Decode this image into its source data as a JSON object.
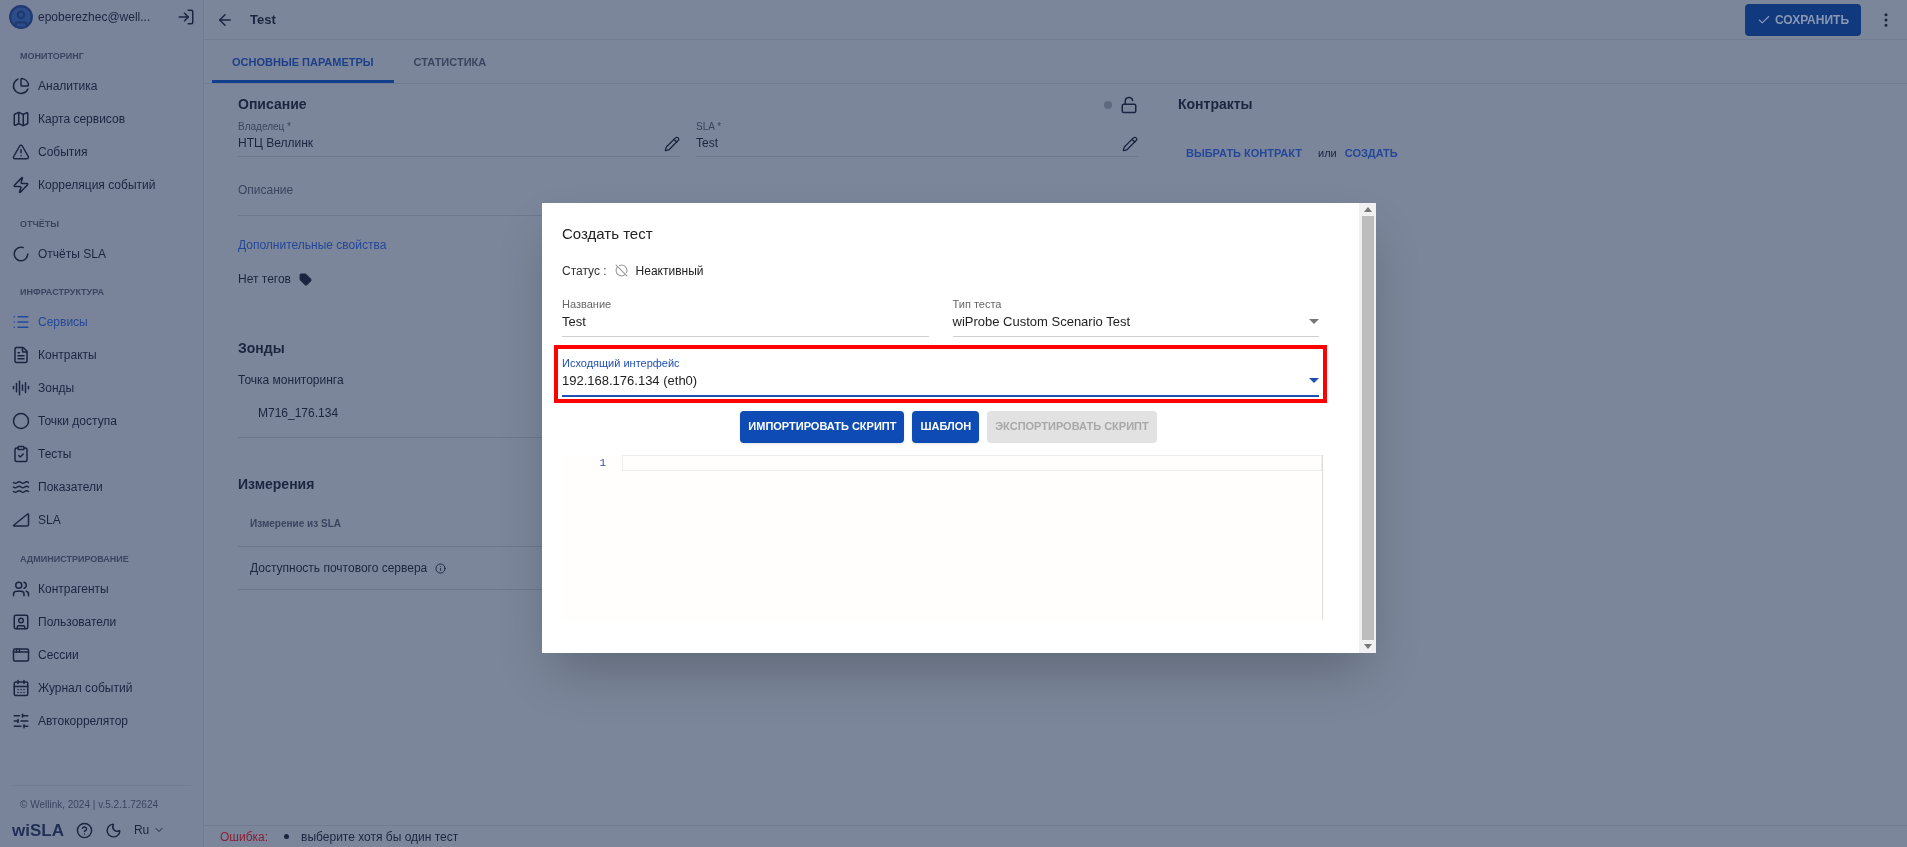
{
  "user": {
    "name": "epoberezhec@well..."
  },
  "sidebar": {
    "sections": [
      {
        "title": "МОНИТОРИНГ",
        "items": [
          {
            "label": "Аналитика",
            "selected": false
          },
          {
            "label": "Карта сервисов",
            "selected": false
          },
          {
            "label": "События",
            "selected": false
          },
          {
            "label": "Корреляция событий",
            "selected": false
          }
        ]
      },
      {
        "title": "ОТЧЁТЫ",
        "items": [
          {
            "label": "Отчёты SLA",
            "selected": false
          }
        ]
      },
      {
        "title": "ИНФРАСТРУКТУРА",
        "items": [
          {
            "label": "Сервисы",
            "selected": true
          },
          {
            "label": "Контракты",
            "selected": false
          },
          {
            "label": "Зонды",
            "selected": false
          },
          {
            "label": "Точки доступа",
            "selected": false
          },
          {
            "label": "Тесты",
            "selected": false
          },
          {
            "label": "Показатели",
            "selected": false
          },
          {
            "label": "SLA",
            "selected": false
          }
        ]
      },
      {
        "title": "АДМИНИСТРИРОВАНИЕ",
        "items": [
          {
            "label": "Контрагенты",
            "selected": false
          },
          {
            "label": "Пользователи",
            "selected": false
          },
          {
            "label": "Сессии",
            "selected": false
          },
          {
            "label": "Журнал событий",
            "selected": false
          },
          {
            "label": "Автокоррелятор",
            "selected": false
          }
        ]
      }
    ],
    "footer": "© Wellink, 2024 | v.5.2.1.72624",
    "logo": "wiSLA",
    "language": "Ru"
  },
  "header": {
    "title": "Test",
    "save_button": "СОХРАНИТЬ"
  },
  "tabs": [
    {
      "label": "ОСНОВНЫЕ ПАРАМЕТРЫ",
      "selected": true
    },
    {
      "label": "СТАТИСТИКА",
      "selected": false
    }
  ],
  "description": {
    "title": "Описание",
    "owner": {
      "label": "Владелец *",
      "value": "НТЦ Веллинк"
    },
    "sla": {
      "label": "SLA *",
      "value": "Test"
    },
    "description_placeholder": "Описание",
    "extra_link": "Дополнительные свойства",
    "tags": "Нет тегов"
  },
  "probes": {
    "title": "Зонды",
    "column": "Точка мониторинга",
    "rows": [
      "M716_176.134"
    ]
  },
  "measurements": {
    "title": "Измерения",
    "column": "Измерение из SLA",
    "rows": [
      "Доступность почтового сервера"
    ]
  },
  "contracts": {
    "title": "Контракты",
    "choose": "ВЫБРАТЬ КОНТРАКТ",
    "or": "или",
    "create": "СОЗДАТЬ"
  },
  "error_bar": {
    "label": "Ошибка:",
    "messages": [
      "выберите хотя бы один тест"
    ]
  },
  "dialog": {
    "title": "Создать тест",
    "status_label": "Статус :",
    "status": "Неактивный",
    "fields": [
      {
        "kind": "text",
        "label": "Название",
        "value": "Test",
        "focused": false,
        "highlighted": false
      },
      {
        "kind": "select",
        "label": "Тип теста",
        "value": "wiProbe Custom Scenario Test",
        "focused": false,
        "highlighted": false
      },
      {
        "kind": "select",
        "label": "Исходящий интерфейс",
        "value": "192.168.176.134 (eth0)",
        "focused": true,
        "highlighted": true
      }
    ],
    "buttons": [
      {
        "label": "ИМПОРТИРОВАТЬ СКРИПТ",
        "disabled": false
      },
      {
        "label": "ШАБЛОН",
        "disabled": false
      },
      {
        "label": "ЭКСПОРТИРОВАТЬ СКРИПТ",
        "disabled": true
      }
    ],
    "editor": {
      "line_numbers": [
        "1"
      ]
    }
  }
}
